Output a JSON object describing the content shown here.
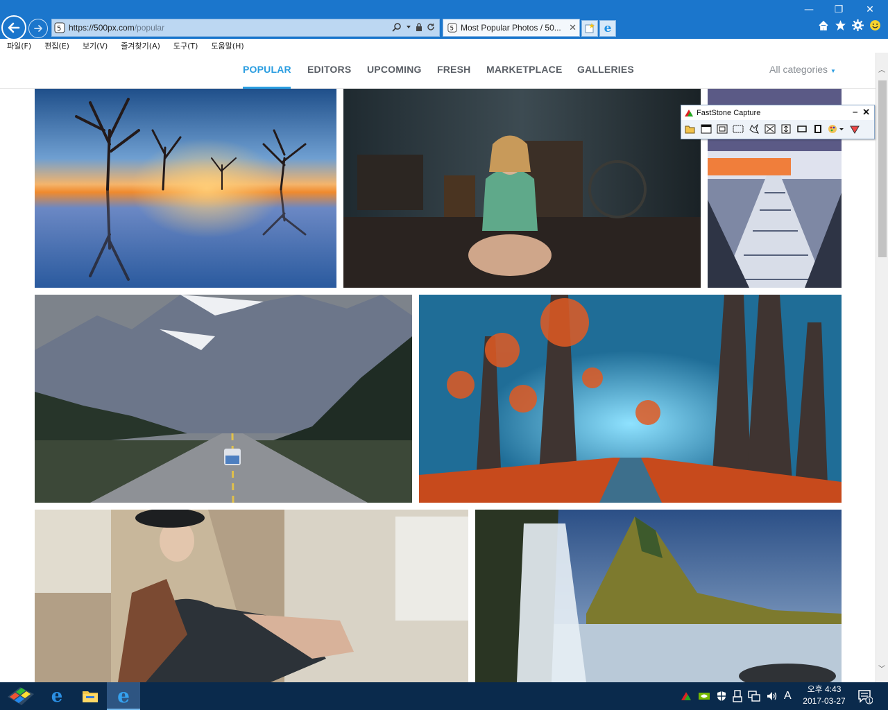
{
  "browser": {
    "url_main": "https://500px.com",
    "url_path": "/popular",
    "tab_title": "Most Popular Photos / 50...",
    "tab_close": "✕",
    "window_controls": [
      "—",
      "❐",
      "✕"
    ]
  },
  "menubar": {
    "items": [
      "파일(F)",
      "편집(E)",
      "보기(V)",
      "즐겨찾기(A)",
      "도구(T)",
      "도움말(H)"
    ]
  },
  "site_nav": {
    "items": [
      "POPULAR",
      "EDITORS",
      "UPCOMING",
      "FRESH",
      "MARKETPLACE",
      "GALLERIES"
    ],
    "active": "POPULAR",
    "category_dropdown": "All categories",
    "accent_color": "#2a9de0"
  },
  "photos": [
    {
      "subject": "dead trees in lake at sunset"
    },
    {
      "subject": "woman kneeling in rustic room"
    },
    {
      "subject": "snowy wooden bridge at dusk"
    },
    {
      "subject": "camper van on mountain road"
    },
    {
      "subject": "autumn tree-lined path in blue fog"
    },
    {
      "subject": "woman in hat seated by window"
    },
    {
      "subject": "waterfall and mountain"
    }
  ],
  "faststone": {
    "title": "FastStone Capture",
    "min": "‒",
    "close": "✕"
  },
  "taskbar": {
    "clock_time": "오후 4:43",
    "clock_date": "2017-03-27",
    "ime": "A",
    "notification_count": "1"
  }
}
